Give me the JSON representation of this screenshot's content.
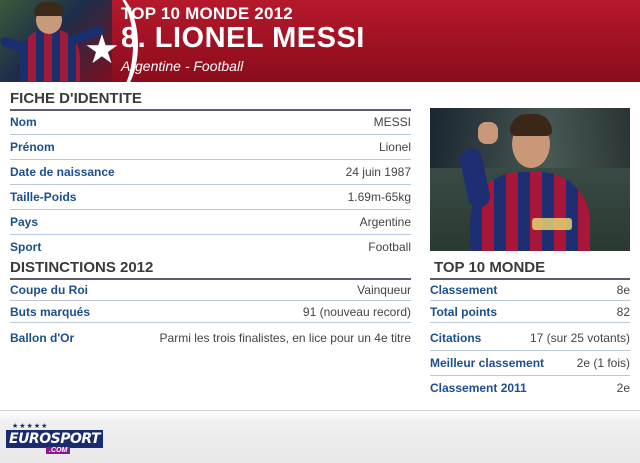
{
  "header": {
    "top_label": "TOP 10 MONDE 2012",
    "player_name": "8. LIONEL MESSI",
    "subtitle": "Argentine - Football"
  },
  "fiche": {
    "title": "FICHE D'IDENTITE",
    "rows": [
      {
        "label": "Nom",
        "value": "MESSI"
      },
      {
        "label": "Prénom",
        "value": "Lionel"
      },
      {
        "label": "Date de naissance",
        "value": "24 juin 1987"
      },
      {
        "label": "Taille-Poids",
        "value": "1.69m-65kg"
      },
      {
        "label": "Pays",
        "value": "Argentine"
      },
      {
        "label": "Sport",
        "value": "Football"
      }
    ]
  },
  "distinctions": {
    "title": "DISTINCTIONS 2012",
    "rows": [
      {
        "label": "Coupe du Roi",
        "value": "Vainqueur"
      },
      {
        "label": "Buts marqués",
        "value": "91 (nouveau record)"
      },
      {
        "label": "Ballon d'Or",
        "value": "Parmi les trois finalistes, en lice pour un 4e titre"
      }
    ]
  },
  "top10": {
    "title": "TOP 10 MONDE",
    "rows": [
      {
        "label": "Classement",
        "value": "8e"
      },
      {
        "label": "Total points",
        "value": "82"
      },
      {
        "label": "Citations",
        "value": "17 (sur 25 votants)"
      },
      {
        "label": "Meilleur classement",
        "value": "2e (1 fois)"
      },
      {
        "label": "Classement 2011",
        "value": "2e"
      }
    ]
  },
  "logo": {
    "euro": "EURO",
    "sport": "SPORT",
    "com": ".COM"
  },
  "colors": {
    "header_red": "#a01424",
    "label_blue": "#1c4f8c",
    "brand_navy": "#1a2a6e"
  }
}
